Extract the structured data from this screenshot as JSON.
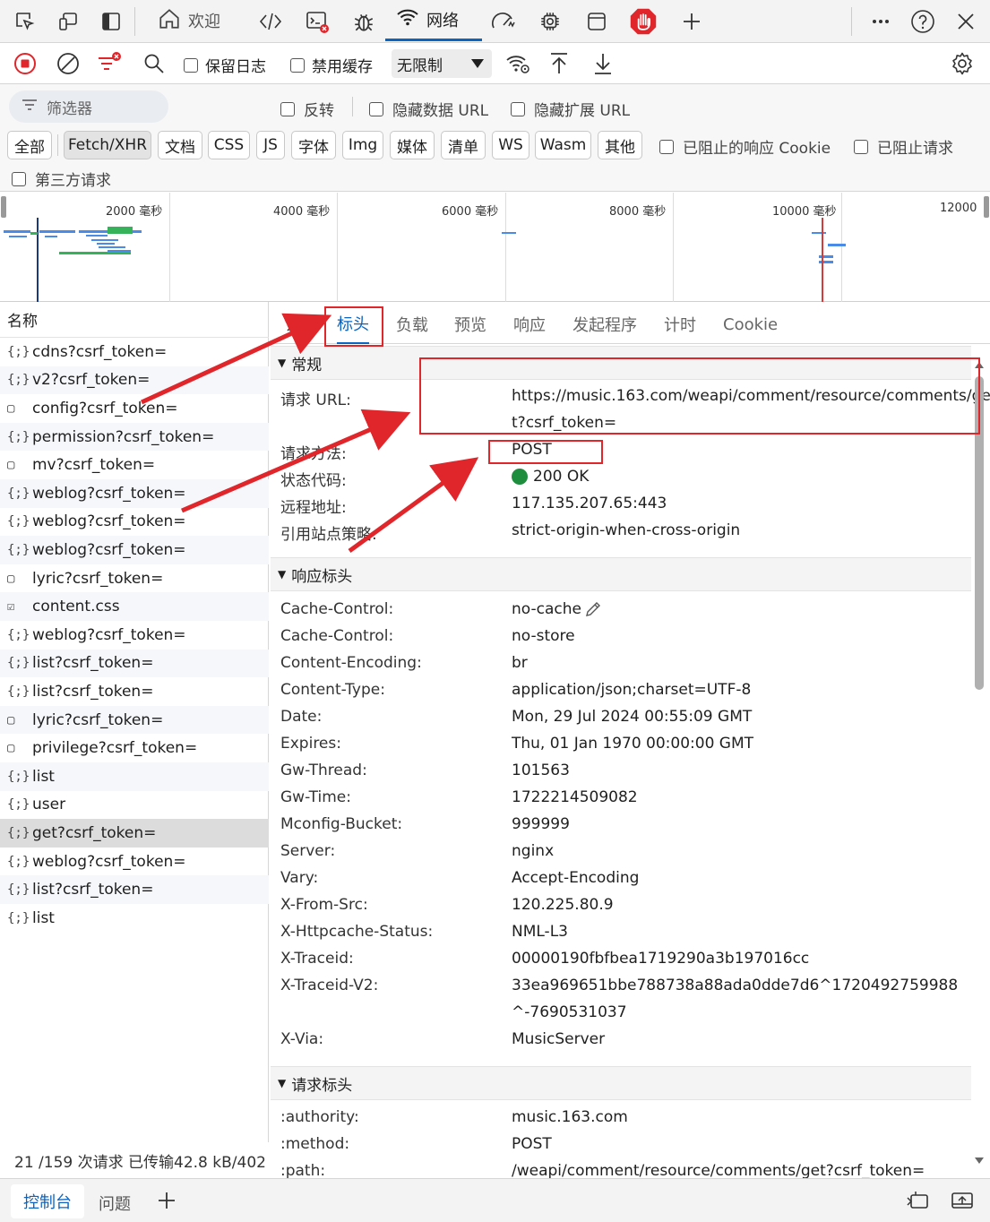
{
  "top_tabs": [
    {
      "label": "欢迎",
      "icon": "home-icon"
    },
    {
      "label": "网络",
      "icon": "wifi-icon"
    }
  ],
  "toolbar": {
    "preserve_log": "保留日志",
    "disable_cache": "禁用缓存",
    "throttle": "无限制"
  },
  "filter": {
    "placeholder": "筛选器",
    "invert": "反转",
    "hide_data_url": "隐藏数据 URL",
    "hide_ext_url": "隐藏扩展 URL",
    "types": [
      "全部",
      "Fetch/XHR",
      "文档",
      "CSS",
      "JS",
      "字体",
      "Img",
      "媒体",
      "清单",
      "WS",
      "Wasm",
      "其他"
    ],
    "selected_type": "Fetch/XHR",
    "blocked_cookies": "已阻止的响应 Cookie",
    "blocked_requests": "已阻止请求",
    "third_party": "第三方请求"
  },
  "timeline": {
    "ticks": [
      "2000  毫秒",
      "4000  毫秒",
      "6000  毫秒",
      "8000  毫秒",
      "10000  毫秒",
      "12000"
    ]
  },
  "request_list": {
    "header": "名称",
    "items": [
      {
        "name": "cdns?csrf_token=",
        "icon": "fetch-icon"
      },
      {
        "name": "v2?csrf_token=",
        "icon": "fetch-icon"
      },
      {
        "name": "config?csrf_token=",
        "icon": "document-icon"
      },
      {
        "name": "permission?csrf_token=",
        "icon": "fetch-icon"
      },
      {
        "name": "mv?csrf_token=",
        "icon": "document-icon"
      },
      {
        "name": "weblog?csrf_token=",
        "icon": "fetch-icon"
      },
      {
        "name": "weblog?csrf_token=",
        "icon": "fetch-icon"
      },
      {
        "name": "weblog?csrf_token=",
        "icon": "fetch-icon"
      },
      {
        "name": "lyric?csrf_token=",
        "icon": "document-icon"
      },
      {
        "name": "content.css",
        "icon": "stylesheet-icon"
      },
      {
        "name": "weblog?csrf_token=",
        "icon": "fetch-icon"
      },
      {
        "name": "list?csrf_token=",
        "icon": "fetch-icon"
      },
      {
        "name": "list?csrf_token=",
        "icon": "fetch-icon"
      },
      {
        "name": "lyric?csrf_token=",
        "icon": "document-icon"
      },
      {
        "name": "privilege?csrf_token=",
        "icon": "document-icon"
      },
      {
        "name": "list",
        "icon": "fetch-icon"
      },
      {
        "name": "user",
        "icon": "fetch-icon"
      },
      {
        "name": "get?csrf_token=",
        "icon": "fetch-icon",
        "selected": true
      },
      {
        "name": "weblog?csrf_token=",
        "icon": "fetch-icon"
      },
      {
        "name": "list?csrf_token=",
        "icon": "fetch-icon"
      },
      {
        "name": "list",
        "icon": "fetch-icon"
      }
    ],
    "status": "21 /159 次请求  已传输42.8 kB/402"
  },
  "detail_tabs": [
    "标头",
    "负载",
    "预览",
    "响应",
    "发起程序",
    "计时",
    "Cookie"
  ],
  "general": {
    "title": "常规",
    "rows": [
      {
        "key": "请求 URL:",
        "value": "https://music.163.com/weapi/comment/resource/comments/ge",
        "value2": "t?csrf_token="
      },
      {
        "key": "请求方法:",
        "value": "POST"
      },
      {
        "key": "状态代码:",
        "value": "200 OK"
      },
      {
        "key": "远程地址:",
        "value": "117.135.207.65:443"
      },
      {
        "key": "引用站点策略:",
        "value": "strict-origin-when-cross-origin"
      }
    ]
  },
  "response_headers": {
    "title": "响应标头",
    "rows": [
      {
        "key": "Cache-Control:",
        "value": "no-cache"
      },
      {
        "key": "Cache-Control:",
        "value": "no-store"
      },
      {
        "key": "Content-Encoding:",
        "value": "br"
      },
      {
        "key": "Content-Type:",
        "value": "application/json;charset=UTF-8"
      },
      {
        "key": "Date:",
        "value": "Mon, 29 Jul 2024 00:55:09 GMT"
      },
      {
        "key": "Expires:",
        "value": "Thu, 01 Jan 1970 00:00:00 GMT"
      },
      {
        "key": "Gw-Thread:",
        "value": "101563"
      },
      {
        "key": "Gw-Time:",
        "value": "1722214509082"
      },
      {
        "key": "Mconfig-Bucket:",
        "value": "999999"
      },
      {
        "key": "Server:",
        "value": "nginx"
      },
      {
        "key": "Vary:",
        "value": "Accept-Encoding"
      },
      {
        "key": "X-From-Src:",
        "value": "120.225.80.9"
      },
      {
        "key": "X-Httpcache-Status:",
        "value": "NML-L3"
      },
      {
        "key": "X-Traceid:",
        "value": "00000190fbfbea1719290a3b197016cc"
      },
      {
        "key": "X-Traceid-V2:",
        "value": "33ea969651bbe788738a88ada0dde7d6^1720492759988",
        "value2": "^-7690531037"
      },
      {
        "key": "X-Via:",
        "value": "MusicServer"
      }
    ]
  },
  "request_headers": {
    "title": "请求标头",
    "rows": [
      {
        "key": ":authority:",
        "value": "music.163.com"
      },
      {
        "key": ":method:",
        "value": "POST"
      },
      {
        "key": ":path:",
        "value": "/weapi/comment/resource/comments/get?csrf_token="
      }
    ]
  },
  "bottom_tabs": [
    "控制台",
    "问题"
  ],
  "colors": {
    "accent": "#0b64c0",
    "annotation": "#e0262b",
    "status_ok": "#1e8e3e"
  }
}
